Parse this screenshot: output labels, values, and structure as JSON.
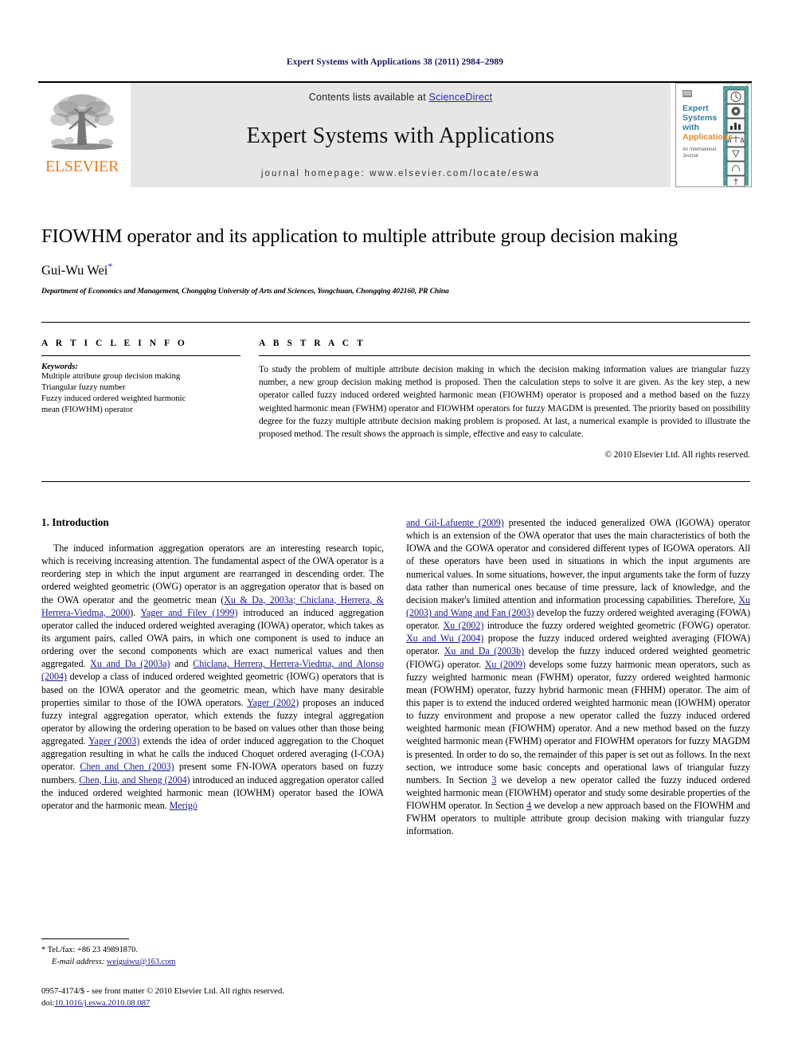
{
  "running_head": "Expert Systems with Applications 38 (2011) 2984–2989",
  "masthead": {
    "contents_prefix": "Contents lists available at ",
    "sciencedirect": "ScienceDirect",
    "journal_name": "Expert Systems with Applications",
    "homepage": "journal homepage: www.elsevier.com/locate/eswa",
    "publisher_logo_text": "ELSEVIER",
    "cover": {
      "line1": "Expert",
      "line2": "Systems",
      "line3": "with",
      "line4": "Applications",
      "subtitle1": "An International",
      "subtitle2": "Journal"
    }
  },
  "title": "FIOWHM operator and its application to multiple attribute group decision making",
  "author": "Gui-Wu Wei",
  "author_marker": "*",
  "affiliation": "Department of Economics and Management, Chongqing University of Arts and Sciences, Yongchuan, Chongqing 402160, PR China",
  "article_info": {
    "heading": "A R T I C L E   I N F O",
    "keywords_label": "Keywords:",
    "keywords": [
      "Multiple attribute group decision making",
      "Triangular fuzzy number",
      "Fuzzy induced ordered weighted harmonic",
      "mean (FIOWHM) operator"
    ]
  },
  "abstract": {
    "heading": "A B S T R A C T",
    "text": "To study the problem of multiple attribute decision making in which the decision making information values are triangular fuzzy number, a new group decision making method is proposed. Then the calculation steps to solve it are given. As the key step, a new operator called fuzzy induced ordered weighted harmonic mean (FIOWHM) operator is proposed and a method based on the fuzzy weighted harmonic mean (FWHM) operator and FIOWHM operators for fuzzy MAGDM is presented. The priority based on possibility degree for the fuzzy multiple attribute decision making problem is proposed. At last, a numerical example is provided to illustrate the proposed method. The result shows the approach is simple, effective and easy to calculate.",
    "copyright": "© 2010 Elsevier Ltd. All rights reserved."
  },
  "body": {
    "section1_title": "1. Introduction",
    "left_paragraph": {
      "segments": [
        {
          "t": "The induced information aggregation operators are an interesting research topic, which is receiving increasing attention. The fundamental aspect of the OWA operator is a reordering step in which the input argument are rearranged in descending order. The ordered weighted geometric (OWG) operator is an aggregation operator that is based on the OWA operator and the geometric mean (",
          "r": false
        },
        {
          "t": "Xu & Da, 2003a; Chiclana, Herrera, & Herrera-Viedma, 2000",
          "r": true
        },
        {
          "t": "). ",
          "r": false
        },
        {
          "t": "Yager and Filev (1999)",
          "r": true
        },
        {
          "t": " introduced an induced aggregation operator called the induced ordered weighted averaging (IOWA) operator, which takes as its argument pairs, called OWA pairs, in which one component is used to induce an ordering over the second components which are exact numerical values and then aggregated. ",
          "r": false
        },
        {
          "t": "Xu and Da (2003a)",
          "r": true
        },
        {
          "t": " and ",
          "r": false
        },
        {
          "t": "Chiclana, Herrera, Herrera-Viedma, and Alonso (2004)",
          "r": true
        },
        {
          "t": " develop a class of induced ordered weighted geometric (IOWG) operators that is based on the IOWA operator and the geometric mean, which have many desirable properties similar to those of the IOWA operators. ",
          "r": false
        },
        {
          "t": "Yager (2002)",
          "r": true
        },
        {
          "t": " proposes an induced fuzzy integral aggregation operator, which extends the fuzzy integral aggregation operator by allowing the ordering operation to be based on values other than those being aggregated. ",
          "r": false
        },
        {
          "t": "Yager (2003)",
          "r": true
        },
        {
          "t": " extends the idea of order induced aggregation to the Choquet aggregation resulting in what he calls the induced Choquet ordered averaging (I-COA) operator. ",
          "r": false
        },
        {
          "t": "Chen and Chen (2003)",
          "r": true
        },
        {
          "t": " present some FN-IOWA operators based on fuzzy numbers. ",
          "r": false
        },
        {
          "t": "Chen, Liu, and Sheng (2004)",
          "r": true
        },
        {
          "t": " introduced an induced aggregation operator called the induced ordered weighted harmonic mean (IOWHM) operator based the IOWA operator and the harmonic mean. ",
          "r": false
        },
        {
          "t": "Merigó",
          "r": true
        }
      ]
    },
    "right_paragraph": {
      "segments": [
        {
          "t": "and Gil-Lafuente (2009)",
          "r": true
        },
        {
          "t": " presented the induced generalized OWA (IGOWA) operator which is an extension of the OWA operator that uses the main characteristics of both the IOWA and the GOWA operator and considered different types of IGOWA operators. All of these operators have been used in situations in which the input arguments are numerical values. In some situations, however, the input arguments take the form of fuzzy data rather than numerical ones because of time pressure, lack of knowledge, and the decision maker's limited attention and information processing capabilities. Therefore, ",
          "r": false
        },
        {
          "t": "Xu (2003) and Wang and Fan (2003)",
          "r": true
        },
        {
          "t": " develop the fuzzy ordered weighted averaging (FOWA) operator. ",
          "r": false
        },
        {
          "t": "Xu (2002)",
          "r": true
        },
        {
          "t": " introduce the fuzzy ordered weighted geometric (FOWG) operator. ",
          "r": false
        },
        {
          "t": "Xu and Wu (2004)",
          "r": true
        },
        {
          "t": " propose the fuzzy induced ordered weighted averaging (FIOWA) operator. ",
          "r": false
        },
        {
          "t": "Xu and Da (2003b)",
          "r": true
        },
        {
          "t": " develop the fuzzy induced ordered weighted geometric (FIOWG) operator. ",
          "r": false
        },
        {
          "t": "Xu (2009)",
          "r": true
        },
        {
          "t": " develops some fuzzy harmonic mean operators, such as fuzzy weighted harmonic mean (FWHM) operator, fuzzy ordered weighted harmonic mean (FOWHM) operator, fuzzy hybrid harmonic mean (FHHM) operator. The aim of this paper is to extend the induced ordered weighted harmonic mean (IOWHM) operator to fuzzy environment and propose a new operator called the fuzzy induced ordered weighted harmonic mean (FIOWHM) operator. And a new method based on the fuzzy weighted harmonic mean (FWHM) operator and FIOWHM operators for fuzzy MAGDM is presented. In order to do so, the remainder of this paper is set out as follows. In the next section, we introduce some basic concepts and operational laws of triangular fuzzy numbers. In Section ",
          "r": false
        },
        {
          "t": "3",
          "r": true
        },
        {
          "t": " we develop a new operator called the fuzzy induced ordered weighted harmonic mean (FIOWHM) operator and study some desirable properties of the FIOWHM operator. In Section ",
          "r": false
        },
        {
          "t": "4",
          "r": true
        },
        {
          "t": " we develop a new approach based on the FIOWHM and FWHM operators to multiple attribute group decision making with triangular fuzzy information.",
          "r": false
        }
      ]
    }
  },
  "footnote": {
    "marker": "*",
    "tel": "Tel./fax: +86 23 49891870.",
    "email_label": "E-mail address:",
    "email": "weiguiwu@163.com"
  },
  "footer": {
    "issn_line": "0957-4174/$ - see front matter © 2010 Elsevier Ltd. All rights reserved.",
    "doi_label": "doi:",
    "doi": "10.1016/j.eswa.2010.08.087"
  },
  "colors": {
    "link": "#1b1b8f",
    "elsevier_orange": "#F07B1D",
    "masthead_gray": "#e6e6e6",
    "cover_teal": "#3f9a94"
  }
}
